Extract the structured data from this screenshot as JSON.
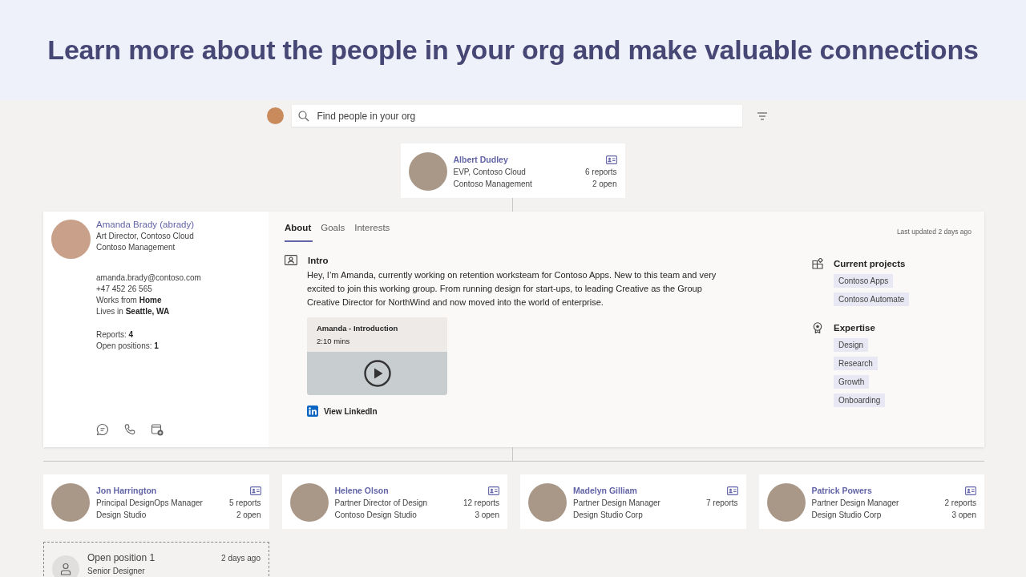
{
  "banner": {
    "title": "Learn more about the people in your org and make valuable connections"
  },
  "search": {
    "placeholder": "Find people in your org"
  },
  "manager": {
    "name": "Albert Dudley",
    "title": "EVP, Contoso Cloud",
    "org": "Contoso Management",
    "reports": "6 reports",
    "open": "2 open"
  },
  "profile": {
    "name": "Amanda Brady (abrady)",
    "title": "Art Director, Contoso Cloud",
    "org": "Contoso Management",
    "contact": [
      "amanda.brady@contoso.com",
      "+47 452 26 565",
      "Works from **Home**",
      "Lives in **Seattle, WA**"
    ],
    "stats": [
      "Reports: **4**",
      "Open positions: **1**"
    ],
    "tabs": [
      {
        "label": "About",
        "selected": true
      },
      {
        "label": "Goals",
        "selected": false
      },
      {
        "label": "Interests",
        "selected": false
      }
    ],
    "last_updated": "Last updated 2 days ago",
    "intro": {
      "heading": "Intro",
      "text": "Hey, I’m Amanda, currently working on retention worksteam for Contoso Apps. New to this team and very excited to join this working group. From running design for start-ups, to leading Creative as the Group Creative Director for NorthWind and now moved into the world of enterprise."
    },
    "video": {
      "title": "Amanda - Introduction",
      "duration": "2:10 mins"
    },
    "linkedin": "View LinkedIn",
    "projects": {
      "heading": "Current projects",
      "items": [
        "Contoso Apps",
        "Contoso Automate"
      ]
    },
    "expertise": {
      "heading": "Expertise",
      "items": [
        "Design",
        "Research",
        "Growth",
        "Onboarding"
      ]
    }
  },
  "reports": [
    {
      "name": "Jon Harrington",
      "title": "Principal DesignOps Manager",
      "org": "Design Studio",
      "reports": "5 reports",
      "open": "2 open"
    },
    {
      "name": "Helene Olson",
      "title": "Partner Director of Design",
      "org": "Contoso Design Studio",
      "reports": "12 reports",
      "open": "3 open"
    },
    {
      "name": "Madelyn Gilliam",
      "title": "Partner Design Manager",
      "org": "Design Studio Corp",
      "reports": "7 reports"
    },
    {
      "name": "Patrick Powers",
      "title": "Partner Design Manager",
      "org": "Design Studio Corp",
      "reports": "2 reports",
      "open": "3 open"
    }
  ],
  "open_positions": [
    {
      "title": "Open position 1",
      "role": "Senior Designer",
      "time": "2 days ago"
    }
  ]
}
